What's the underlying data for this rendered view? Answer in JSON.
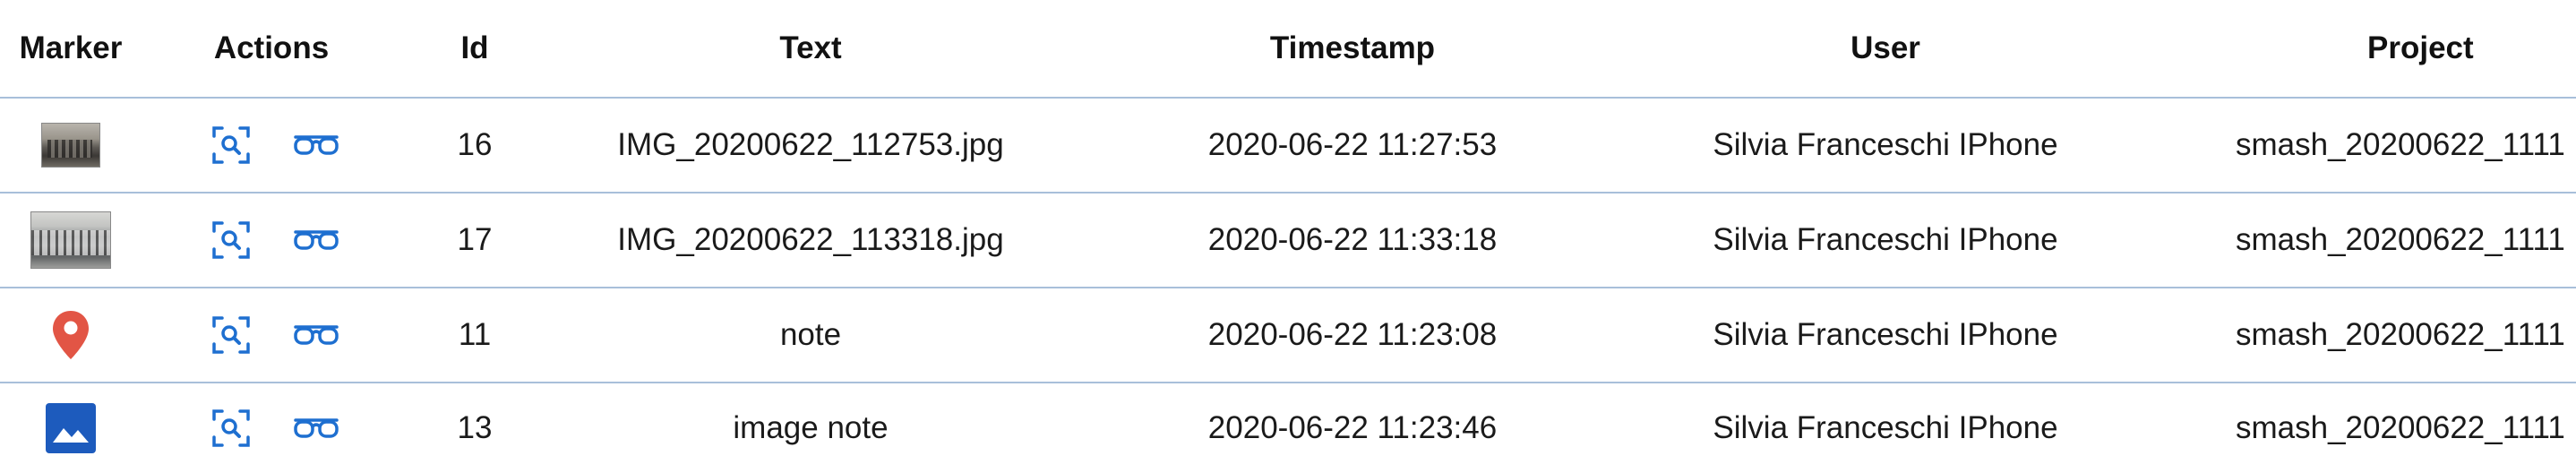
{
  "headers": {
    "marker": "Marker",
    "actions": "Actions",
    "id": "Id",
    "text": "Text",
    "timestamp": "Timestamp",
    "user": "User",
    "project": "Project"
  },
  "rows": [
    {
      "marker_type": "photo-thumbnail",
      "id": "16",
      "text": "IMG_20200622_112753.jpg",
      "timestamp": "2020-06-22 11:27:53",
      "user": "Silvia Franceschi IPhone",
      "project": "smash_20200622_1111"
    },
    {
      "marker_type": "photo-thumbnail",
      "id": "17",
      "text": "IMG_20200622_113318.jpg",
      "timestamp": "2020-06-22 11:33:18",
      "user": "Silvia Franceschi IPhone",
      "project": "smash_20200622_1111"
    },
    {
      "marker_type": "map-pin-icon",
      "id": "11",
      "text": "note",
      "timestamp": "2020-06-22 11:23:08",
      "user": "Silvia Franceschi IPhone",
      "project": "smash_20200622_1111"
    },
    {
      "marker_type": "image-icon",
      "id": "13",
      "text": "image note",
      "timestamp": "2020-06-22 11:23:46",
      "user": "Silvia Franceschi IPhone",
      "project": "smash_20200622_1111"
    }
  ],
  "action_icons": [
    "zoom-to-icon",
    "glasses-view-icon"
  ],
  "colors": {
    "action_icon": "#1e6fd0",
    "pin": "#e25545",
    "image_icon_bg": "#1d5bbd",
    "row_border": "#a8bfda"
  }
}
